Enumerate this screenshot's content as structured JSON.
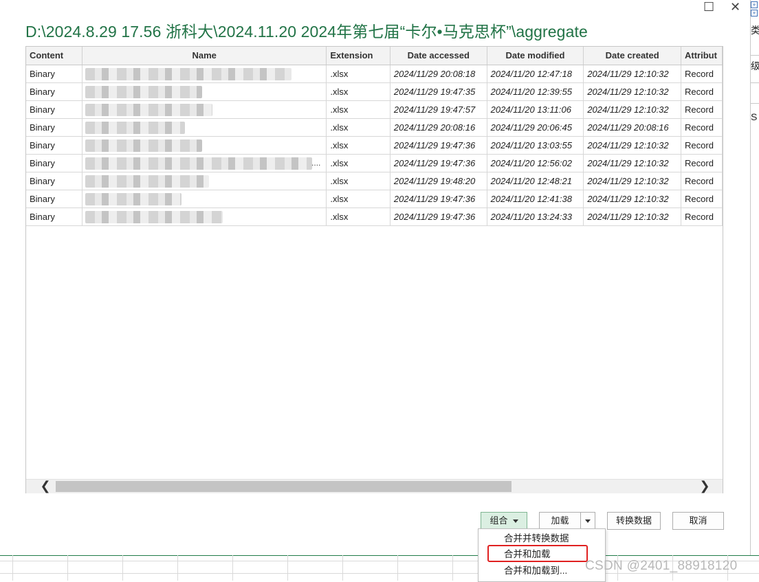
{
  "dialog": {
    "title": "D:\\2024.8.29 17.56 浙科大\\2024.11.20 2024年第七届“卡尔•马克思杯”\\aggregate",
    "window_controls": {
      "maximize": "☐",
      "close": "✕"
    }
  },
  "table": {
    "columns": [
      "Content",
      "Name",
      "Extension",
      "Date accessed",
      "Date modified",
      "Date created",
      "Attribut"
    ],
    "rows": [
      {
        "content": "Binary",
        "name": "",
        "extension": ".xlsx",
        "accessed": "2024/11/29 20:08:18",
        "modified": "2024/11/20 12:47:18",
        "created": "2024/11/29 12:10:32",
        "attributes": "Record"
      },
      {
        "content": "Binary",
        "name": "",
        "extension": ".xlsx",
        "accessed": "2024/11/29 19:47:35",
        "modified": "2024/11/20 12:39:55",
        "created": "2024/11/29 12:10:32",
        "attributes": "Record"
      },
      {
        "content": "Binary",
        "name": "",
        "extension": ".xlsx",
        "accessed": "2024/11/29 19:47:57",
        "modified": "2024/11/20 13:11:06",
        "created": "2024/11/29 12:10:32",
        "attributes": "Record"
      },
      {
        "content": "Binary",
        "name": "",
        "extension": ".xlsx",
        "accessed": "2024/11/29 20:08:16",
        "modified": "2024/11/29 20:06:45",
        "created": "2024/11/29 20:08:16",
        "attributes": "Record"
      },
      {
        "content": "Binary",
        "name": "",
        "extension": ".xlsx",
        "accessed": "2024/11/29 19:47:36",
        "modified": "2024/11/20 13:03:55",
        "created": "2024/11/29 12:10:32",
        "attributes": "Record"
      },
      {
        "content": "Binary",
        "name": "....",
        "extension": ".xlsx",
        "accessed": "2024/11/29 19:47:36",
        "modified": "2024/11/20 12:56:02",
        "created": "2024/11/29 12:10:32",
        "attributes": "Record"
      },
      {
        "content": "Binary",
        "name": "",
        "extension": ".xlsx",
        "accessed": "2024/11/29 19:48:20",
        "modified": "2024/11/20 12:48:21",
        "created": "2024/11/29 12:10:32",
        "attributes": "Record"
      },
      {
        "content": "Binary",
        "name": "",
        "extension": ".xlsx",
        "accessed": "2024/11/29 19:47:36",
        "modified": "2024/11/20 12:41:38",
        "created": "2024/11/29 12:10:32",
        "attributes": "Record"
      },
      {
        "content": "Binary",
        "name": "",
        "extension": ".xlsx",
        "accessed": "2024/11/29 19:47:36",
        "modified": "2024/11/20 13:24:33",
        "created": "2024/11/29 12:10:32",
        "attributes": "Record"
      }
    ]
  },
  "scrollbar": {
    "left_arrow": "❮",
    "right_arrow": "❯"
  },
  "buttons": {
    "combine": "组合",
    "load": "加载",
    "transform": "转换数据",
    "cancel": "取消"
  },
  "combine_menu": {
    "items": [
      "合并并转换数据",
      "合并和加载",
      "合并和加载到..."
    ],
    "highlighted_index": 1
  },
  "background_sheet": {
    "side_text": [
      "类",
      "级",
      "S"
    ]
  },
  "watermark": "CSDN @2401_88918120",
  "colors": {
    "title_green": "#217346",
    "active_button_bg": "#dbefe2",
    "highlight_red": "#e02020"
  }
}
